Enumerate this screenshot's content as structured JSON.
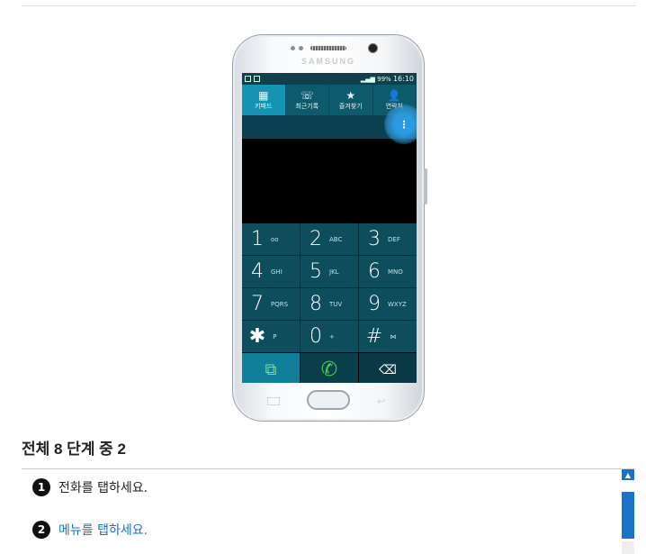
{
  "phone": {
    "brand": "SAMSUNG",
    "status_left": "",
    "status_battery": "99%",
    "status_time": "16:10",
    "tabs": [
      {
        "icon": "▦",
        "label": "키패드",
        "icon_name": "keypad-icon"
      },
      {
        "icon": "☏",
        "label": "최근기록",
        "icon_name": "recent-calls-icon"
      },
      {
        "icon": "★",
        "label": "즐겨찾기",
        "icon_name": "favorites-icon"
      },
      {
        "icon": "👤",
        "label": "연락처",
        "icon_name": "contacts-icon"
      }
    ],
    "menu_icon": "⋮",
    "keys": [
      {
        "digit": "1",
        "letters": "oo"
      },
      {
        "digit": "2",
        "letters": "ABC"
      },
      {
        "digit": "3",
        "letters": "DEF"
      },
      {
        "digit": "4",
        "letters": "GHI"
      },
      {
        "digit": "5",
        "letters": "JKL"
      },
      {
        "digit": "6",
        "letters": "MNO"
      },
      {
        "digit": "7",
        "letters": "PQRS"
      },
      {
        "digit": "8",
        "letters": "TUV"
      },
      {
        "digit": "9",
        "letters": "WXYZ"
      },
      {
        "digit": "✱",
        "letters": "P"
      },
      {
        "digit": "0",
        "letters": "+"
      },
      {
        "digit": "#",
        "letters": "⋈"
      }
    ],
    "bottom": {
      "contacts_icon": "⧉",
      "call_icon": "✆",
      "delete_icon": "⌫"
    },
    "back_icon": "↩"
  },
  "step": {
    "title": "전체 8 단계 중 2",
    "items": [
      {
        "num": "1",
        "text": "전화를 탭하세요."
      },
      {
        "num": "2",
        "text": "메뉴를 탭하세요."
      }
    ]
  },
  "scrollbar": {
    "up_icon": "▲"
  },
  "colors": {
    "accent": "#1a73c9",
    "tab_active": "#1493b2",
    "keypad_bg": "#0d4d5c"
  }
}
